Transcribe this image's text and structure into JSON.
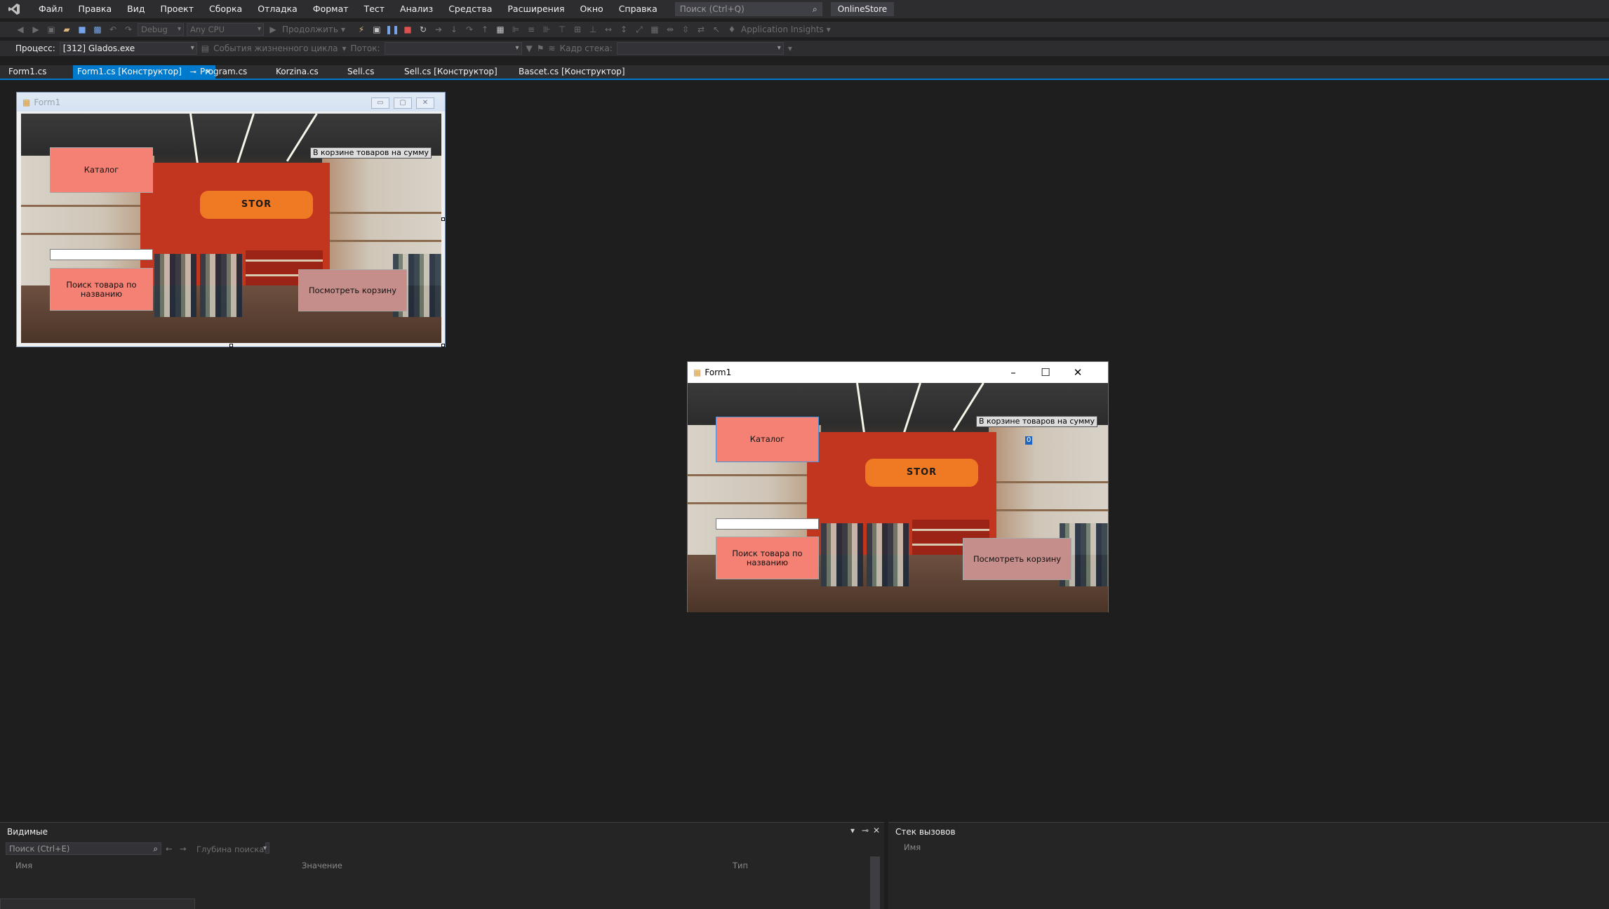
{
  "menubar": {
    "items": [
      "Файл",
      "Правка",
      "Вид",
      "Проект",
      "Сборка",
      "Отладка",
      "Формат",
      "Тест",
      "Анализ",
      "Средства",
      "Расширения",
      "Окно",
      "Справка"
    ],
    "search_placeholder": "Поиск (Ctrl+Q)",
    "solution_name": "OnlineStore"
  },
  "toolbar": {
    "config": "Debug",
    "platform": "Any CPU",
    "continue_label": "Продолжить",
    "insights_label": "Application Insights"
  },
  "debugbar": {
    "process_label": "Процесс:",
    "process_value": "[312] Glados.exe",
    "lifecycle_label": "События жизненного цикла",
    "thread_label": "Поток:",
    "stack_frame_label": "Кадр стека:"
  },
  "tabs": [
    {
      "label": "Form1.cs"
    },
    {
      "label": "Form1.cs [Конструктор]"
    },
    {
      "label": "Program.cs"
    },
    {
      "label": "Korzina.cs"
    },
    {
      "label": "Sell.cs"
    },
    {
      "label": "Sell.cs [Конструктор]"
    },
    {
      "label": "Bascet.cs [Конструктор]"
    }
  ],
  "form": {
    "title": "Form1",
    "catalog_button": "Каталог",
    "search_button": "Поиск товара по названию",
    "view_cart_button": "Посмотреть корзину",
    "cart_label": "В корзине товаров на сумму",
    "cart_sum": "0",
    "store_sign": "STOR"
  },
  "colors": {
    "accent": "#007acc",
    "button_salmon": "#f48174",
    "button_rose": "#c58e8b",
    "sign_orange": "#f07a24"
  },
  "locals_panel": {
    "title": "Видимые",
    "search_placeholder": "Поиск (Ctrl+E)",
    "depth_label": "Глубина поиска:",
    "columns": [
      "Имя",
      "Значение",
      "Тип"
    ]
  },
  "callstack_panel": {
    "title": "Стек вызовов",
    "columns": [
      "Имя"
    ]
  }
}
